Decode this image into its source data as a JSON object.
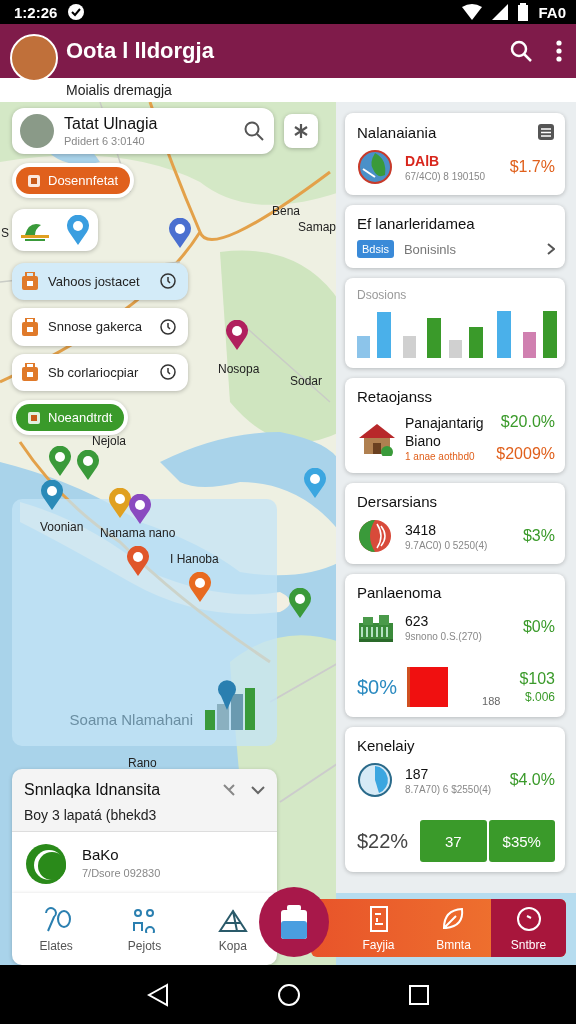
{
  "status_bar": {
    "time": "1:2:26",
    "carrier": "FA0"
  },
  "app_bar": {
    "title": "Oota l lldorgja",
    "subtitle": "Moialis dremagja"
  },
  "profile_card": {
    "name": "Tatat Ulnagia",
    "detail": "Pdidert 6 3:0140"
  },
  "left_panel": {
    "items": [
      {
        "kind": "chip",
        "label": "Dosennfetat"
      },
      {
        "kind": "icons"
      },
      {
        "kind": "place",
        "label": "Vahoos jostacet",
        "selected": true
      },
      {
        "kind": "place",
        "label": "Snnose gakerca",
        "selected": false
      },
      {
        "kind": "place",
        "label": "Sb corlariocpiar",
        "selected": false
      },
      {
        "kind": "chip",
        "label": "Noeandtrdt"
      }
    ]
  },
  "map": {
    "labels": [
      "Bena",
      "Samap",
      "S",
      "Nosopa",
      "Sodar",
      "Nejola",
      "Voonian",
      "Nanama nano",
      "I Hanoba",
      "Rano"
    ],
    "pins": [
      {
        "color": "#4a6fd0"
      },
      {
        "color": "#b0205e"
      },
      {
        "color": "#3a9a3a"
      },
      {
        "color": "#3a9a3a"
      },
      {
        "color": "#2a8ab8"
      },
      {
        "color": "#e0a020"
      },
      {
        "color": "#8a4ac0"
      },
      {
        "color": "#e0562a"
      },
      {
        "color": "#e86a20"
      },
      {
        "color": "#3ba6e0"
      },
      {
        "color": "#3a9a3a"
      }
    ]
  },
  "region_panel": {
    "label": "Soama Nlamahani"
  },
  "sheet": {
    "title": "Snnlaqka Idnansita",
    "subtitle": "Boy 3 lapatá (bhekd3",
    "entry": {
      "name": "BaKo",
      "detail": "7/Dsore 092830"
    }
  },
  "cards": [
    {
      "kind": "stat",
      "title": "Nalanaiania",
      "headline": "DAlB",
      "caption": "67/4C0) 8 190150",
      "values": [
        "$1.7%"
      ]
    },
    {
      "kind": "link",
      "title": "Ef lanarleridamea",
      "tag": "Bdsis",
      "text": "Bonisinls"
    },
    {
      "kind": "chart",
      "title": "Dsosions"
    },
    {
      "kind": "stat",
      "title": "Retaojanss",
      "headline": "Panajantarig",
      "subhead": "Biano",
      "caption": "1 anae aothbd0",
      "values": [
        "$20.0%",
        "$2009%"
      ]
    },
    {
      "kind": "stat",
      "title": "Dersarsians",
      "headline": "3418",
      "caption": "9.7AC0) 0 5250(4)",
      "values": [
        "$3%"
      ]
    },
    {
      "kind": "stat",
      "title": "Panlaenoma",
      "headline": "623",
      "caption": "9snono 0.S.(270)",
      "values": [
        "$0%"
      ],
      "footer": {
        "kind": "swatch",
        "lead": "$0%",
        "note": "188",
        "values": [
          "$103",
          "$.006"
        ]
      }
    },
    {
      "kind": "stat",
      "title": "Kenelaiy",
      "headline": "187",
      "caption": "8.7A70) 6 $2550(4)",
      "values": [
        "$4.0%"
      ],
      "footer": {
        "kind": "buttons",
        "lead": "$22%",
        "buttons": [
          "37",
          "$35%"
        ]
      }
    }
  ],
  "bottom_nav": {
    "left_items": [
      {
        "label": "Elates",
        "selected": false
      },
      {
        "label": "Pejots",
        "selected": false
      },
      {
        "label": "Kopa",
        "selected": false
      }
    ],
    "right_items": [
      {
        "label": "Fayjia",
        "selected": false
      },
      {
        "label": "Bmnta",
        "selected": false
      },
      {
        "label": "Sntbre",
        "selected": true
      }
    ]
  }
}
